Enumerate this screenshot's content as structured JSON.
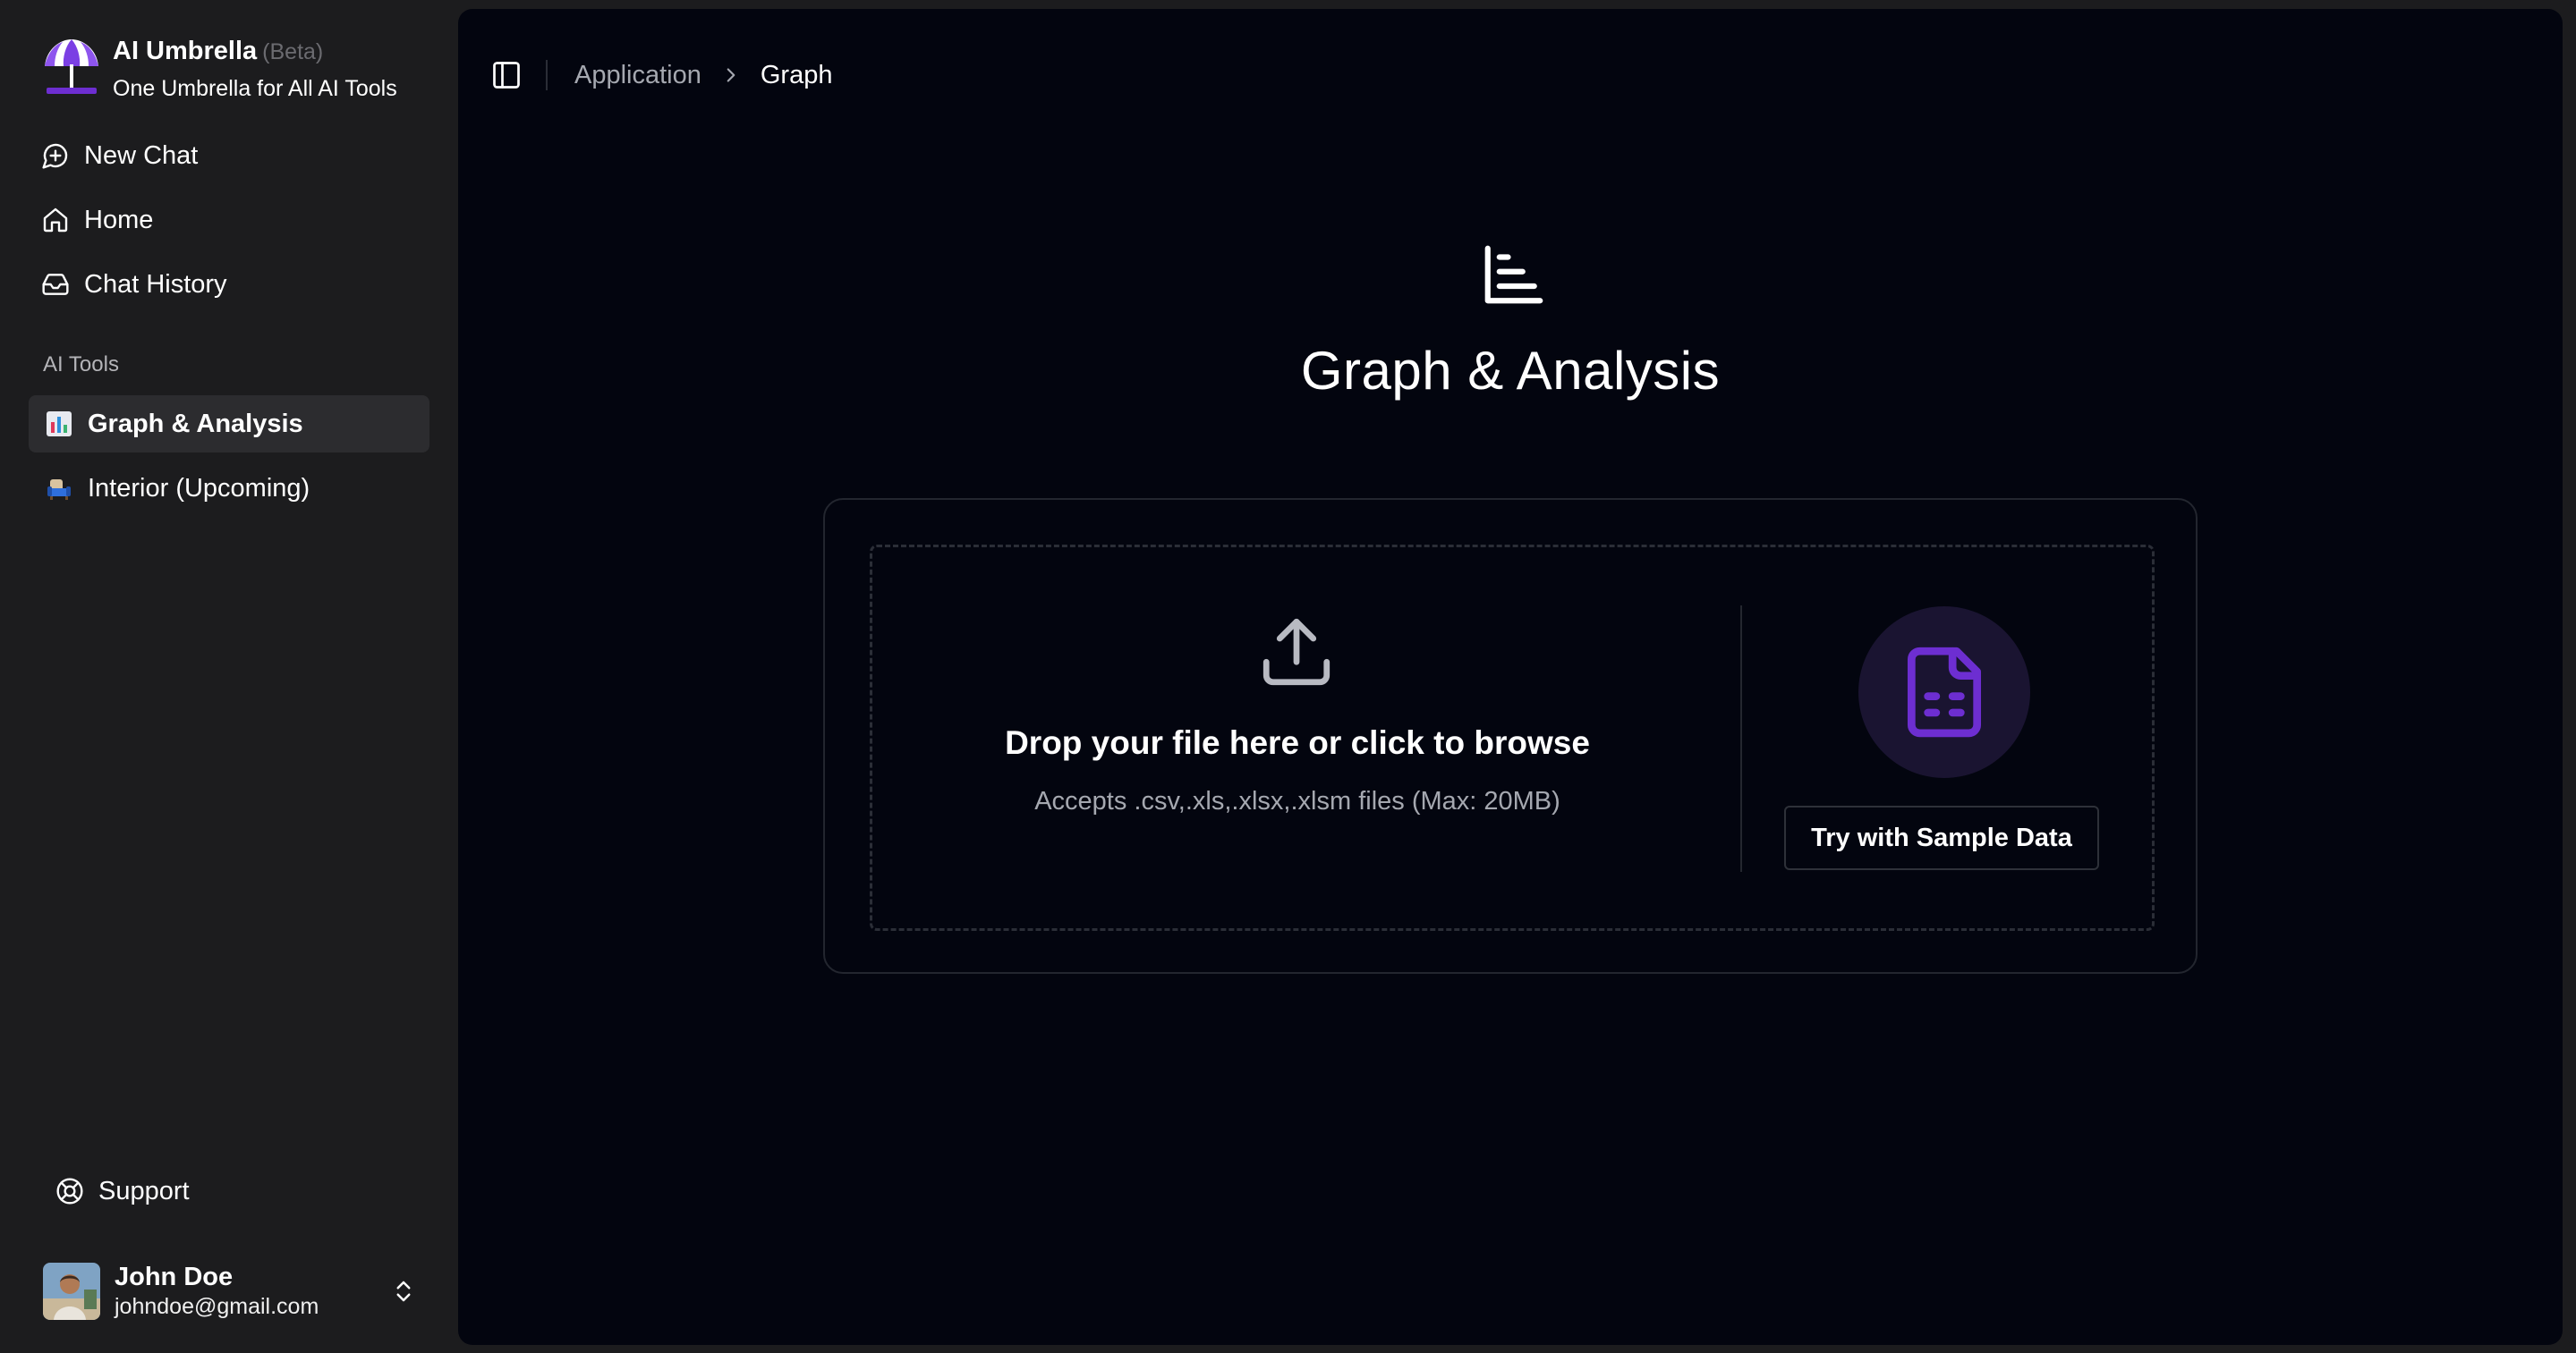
{
  "brand": {
    "name": "AI Umbrella",
    "badge": "(Beta)",
    "tagline": "One Umbrella for All AI Tools"
  },
  "nav": {
    "items": [
      {
        "label": "New Chat",
        "icon": "message-plus-icon"
      },
      {
        "label": "Home",
        "icon": "home-icon"
      },
      {
        "label": "Chat History",
        "icon": "inbox-icon"
      }
    ]
  },
  "tools": {
    "section_label": "AI Tools",
    "items": [
      {
        "label": "Graph & Analysis",
        "icon": "bar-chart-emoji-icon",
        "active": true
      },
      {
        "label": "Interior (Upcoming)",
        "icon": "armchair-emoji-icon",
        "active": false
      }
    ]
  },
  "support": {
    "label": "Support",
    "icon": "lifebuoy-icon"
  },
  "user": {
    "name": "John Doe",
    "email": "johndoe@gmail.com"
  },
  "breadcrumb": {
    "parent": "Application",
    "current": "Graph"
  },
  "page": {
    "title": "Graph & Analysis"
  },
  "upload": {
    "title": "Drop your file here or click to browse",
    "subtitle": "Accepts .csv,.xls,.xlsx,.xlsm files (Max: 20MB)",
    "sample_button": "Try with Sample Data"
  },
  "colors": {
    "accent_purple": "#6d2ed1",
    "sidebar_bg": "#1c1c1e",
    "main_bg": "#03050f",
    "active_item_bg": "#2c2c2f"
  }
}
